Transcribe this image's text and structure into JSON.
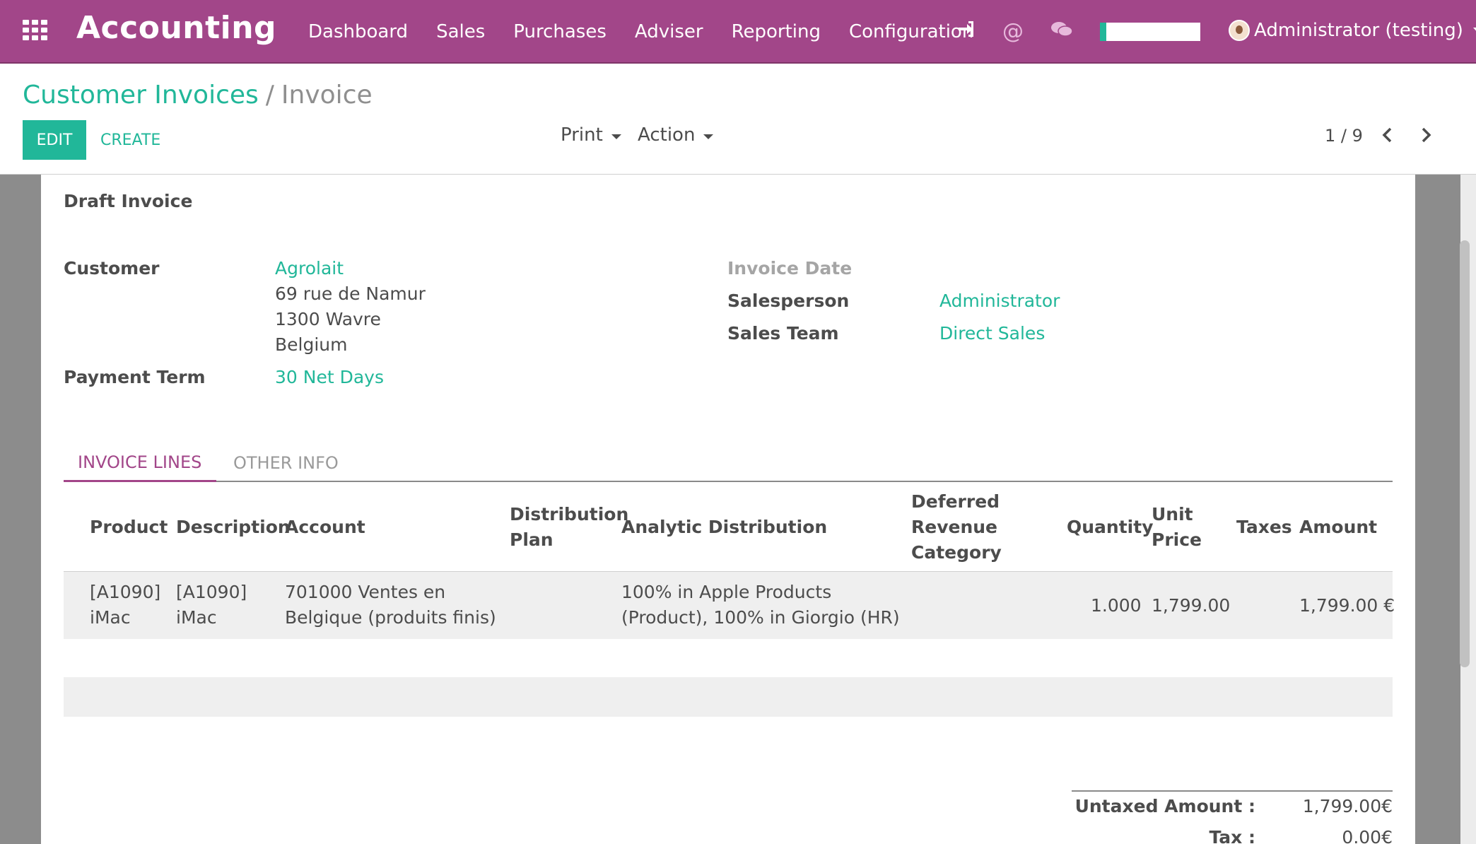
{
  "navbar": {
    "app_title": "Accounting",
    "menu": [
      "Dashboard",
      "Sales",
      "Purchases",
      "Adviser",
      "Reporting",
      "Configuration"
    ],
    "icons": [
      "sign-in-icon",
      "at-icon",
      "chat-icon"
    ],
    "user": "Administrator (testing)",
    "brand_color": "#a24689"
  },
  "control": {
    "breadcrumb_parent": "Customer Invoices",
    "breadcrumb_sep": "/",
    "breadcrumb_current": "Invoice",
    "edit_label": "EDIT",
    "create_label": "CREATE",
    "print_label": "Print",
    "action_label": "Action",
    "pager": "1 / 9",
    "accent_color": "#21b799"
  },
  "form": {
    "status": "Draft Invoice",
    "customer_label": "Customer",
    "customer_name": "Agrolait",
    "address_line1": "69 rue de Namur",
    "address_line2": "1300 Wavre",
    "address_line3": "Belgium",
    "payment_term_label": "Payment Term",
    "payment_term": "30 Net Days",
    "invoice_date_label": "Invoice Date",
    "salesperson_label": "Salesperson",
    "salesperson": "Administrator",
    "sales_team_label": "Sales Team",
    "sales_team": "Direct Sales"
  },
  "tabs": [
    "INVOICE LINES",
    "OTHER INFO"
  ],
  "table": {
    "headers": {
      "product": "Product",
      "description": "Description",
      "account": "Account",
      "distribution_plan_1": "Distribution",
      "distribution_plan_2": "Plan",
      "analytic": "Analytic Distribution",
      "deferred_1": "Deferred",
      "deferred_2": "Revenue",
      "deferred_3": "Category",
      "quantity": "Quantity",
      "unit_price_1": "Unit",
      "unit_price_2": "Price",
      "taxes": "Taxes",
      "amount": "Amount"
    },
    "rows": [
      {
        "product_1": "[A1090]",
        "product_2": "iMac",
        "description_1": "[A1090]",
        "description_2": "iMac",
        "account_1": "701000 Ventes en",
        "account_2": "Belgique (produits finis)",
        "analytic_1": "100% in Apple Products",
        "analytic_2": "(Product), 100% in Giorgio (HR)",
        "quantity": "1.000",
        "unit_price": "1,799.00",
        "amount": "1,799.00 €"
      }
    ]
  },
  "totals": {
    "untaxed_label": "Untaxed Amount :",
    "untaxed_value": "1,799.00€",
    "tax_label": "Tax :",
    "tax_value": "0.00€"
  }
}
